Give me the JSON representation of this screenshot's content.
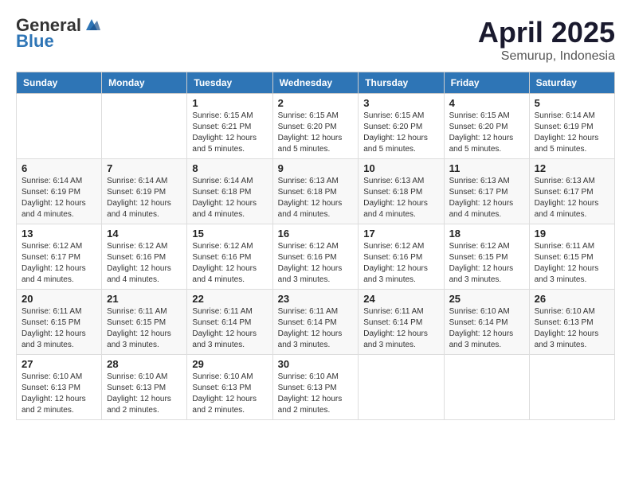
{
  "header": {
    "logo_general": "General",
    "logo_blue": "Blue",
    "month": "April 2025",
    "location": "Semurup, Indonesia"
  },
  "days_of_week": [
    "Sunday",
    "Monday",
    "Tuesday",
    "Wednesday",
    "Thursday",
    "Friday",
    "Saturday"
  ],
  "weeks": [
    [
      {
        "day": "",
        "info": ""
      },
      {
        "day": "",
        "info": ""
      },
      {
        "day": "1",
        "info": "Sunrise: 6:15 AM\nSunset: 6:21 PM\nDaylight: 12 hours\nand 5 minutes."
      },
      {
        "day": "2",
        "info": "Sunrise: 6:15 AM\nSunset: 6:20 PM\nDaylight: 12 hours\nand 5 minutes."
      },
      {
        "day": "3",
        "info": "Sunrise: 6:15 AM\nSunset: 6:20 PM\nDaylight: 12 hours\nand 5 minutes."
      },
      {
        "day": "4",
        "info": "Sunrise: 6:15 AM\nSunset: 6:20 PM\nDaylight: 12 hours\nand 5 minutes."
      },
      {
        "day": "5",
        "info": "Sunrise: 6:14 AM\nSunset: 6:19 PM\nDaylight: 12 hours\nand 5 minutes."
      }
    ],
    [
      {
        "day": "6",
        "info": "Sunrise: 6:14 AM\nSunset: 6:19 PM\nDaylight: 12 hours\nand 4 minutes."
      },
      {
        "day": "7",
        "info": "Sunrise: 6:14 AM\nSunset: 6:19 PM\nDaylight: 12 hours\nand 4 minutes."
      },
      {
        "day": "8",
        "info": "Sunrise: 6:14 AM\nSunset: 6:18 PM\nDaylight: 12 hours\nand 4 minutes."
      },
      {
        "day": "9",
        "info": "Sunrise: 6:13 AM\nSunset: 6:18 PM\nDaylight: 12 hours\nand 4 minutes."
      },
      {
        "day": "10",
        "info": "Sunrise: 6:13 AM\nSunset: 6:18 PM\nDaylight: 12 hours\nand 4 minutes."
      },
      {
        "day": "11",
        "info": "Sunrise: 6:13 AM\nSunset: 6:17 PM\nDaylight: 12 hours\nand 4 minutes."
      },
      {
        "day": "12",
        "info": "Sunrise: 6:13 AM\nSunset: 6:17 PM\nDaylight: 12 hours\nand 4 minutes."
      }
    ],
    [
      {
        "day": "13",
        "info": "Sunrise: 6:12 AM\nSunset: 6:17 PM\nDaylight: 12 hours\nand 4 minutes."
      },
      {
        "day": "14",
        "info": "Sunrise: 6:12 AM\nSunset: 6:16 PM\nDaylight: 12 hours\nand 4 minutes."
      },
      {
        "day": "15",
        "info": "Sunrise: 6:12 AM\nSunset: 6:16 PM\nDaylight: 12 hours\nand 4 minutes."
      },
      {
        "day": "16",
        "info": "Sunrise: 6:12 AM\nSunset: 6:16 PM\nDaylight: 12 hours\nand 3 minutes."
      },
      {
        "day": "17",
        "info": "Sunrise: 6:12 AM\nSunset: 6:16 PM\nDaylight: 12 hours\nand 3 minutes."
      },
      {
        "day": "18",
        "info": "Sunrise: 6:12 AM\nSunset: 6:15 PM\nDaylight: 12 hours\nand 3 minutes."
      },
      {
        "day": "19",
        "info": "Sunrise: 6:11 AM\nSunset: 6:15 PM\nDaylight: 12 hours\nand 3 minutes."
      }
    ],
    [
      {
        "day": "20",
        "info": "Sunrise: 6:11 AM\nSunset: 6:15 PM\nDaylight: 12 hours\nand 3 minutes."
      },
      {
        "day": "21",
        "info": "Sunrise: 6:11 AM\nSunset: 6:15 PM\nDaylight: 12 hours\nand 3 minutes."
      },
      {
        "day": "22",
        "info": "Sunrise: 6:11 AM\nSunset: 6:14 PM\nDaylight: 12 hours\nand 3 minutes."
      },
      {
        "day": "23",
        "info": "Sunrise: 6:11 AM\nSunset: 6:14 PM\nDaylight: 12 hours\nand 3 minutes."
      },
      {
        "day": "24",
        "info": "Sunrise: 6:11 AM\nSunset: 6:14 PM\nDaylight: 12 hours\nand 3 minutes."
      },
      {
        "day": "25",
        "info": "Sunrise: 6:10 AM\nSunset: 6:14 PM\nDaylight: 12 hours\nand 3 minutes."
      },
      {
        "day": "26",
        "info": "Sunrise: 6:10 AM\nSunset: 6:13 PM\nDaylight: 12 hours\nand 3 minutes."
      }
    ],
    [
      {
        "day": "27",
        "info": "Sunrise: 6:10 AM\nSunset: 6:13 PM\nDaylight: 12 hours\nand 2 minutes."
      },
      {
        "day": "28",
        "info": "Sunrise: 6:10 AM\nSunset: 6:13 PM\nDaylight: 12 hours\nand 2 minutes."
      },
      {
        "day": "29",
        "info": "Sunrise: 6:10 AM\nSunset: 6:13 PM\nDaylight: 12 hours\nand 2 minutes."
      },
      {
        "day": "30",
        "info": "Sunrise: 6:10 AM\nSunset: 6:13 PM\nDaylight: 12 hours\nand 2 minutes."
      },
      {
        "day": "",
        "info": ""
      },
      {
        "day": "",
        "info": ""
      },
      {
        "day": "",
        "info": ""
      }
    ]
  ]
}
